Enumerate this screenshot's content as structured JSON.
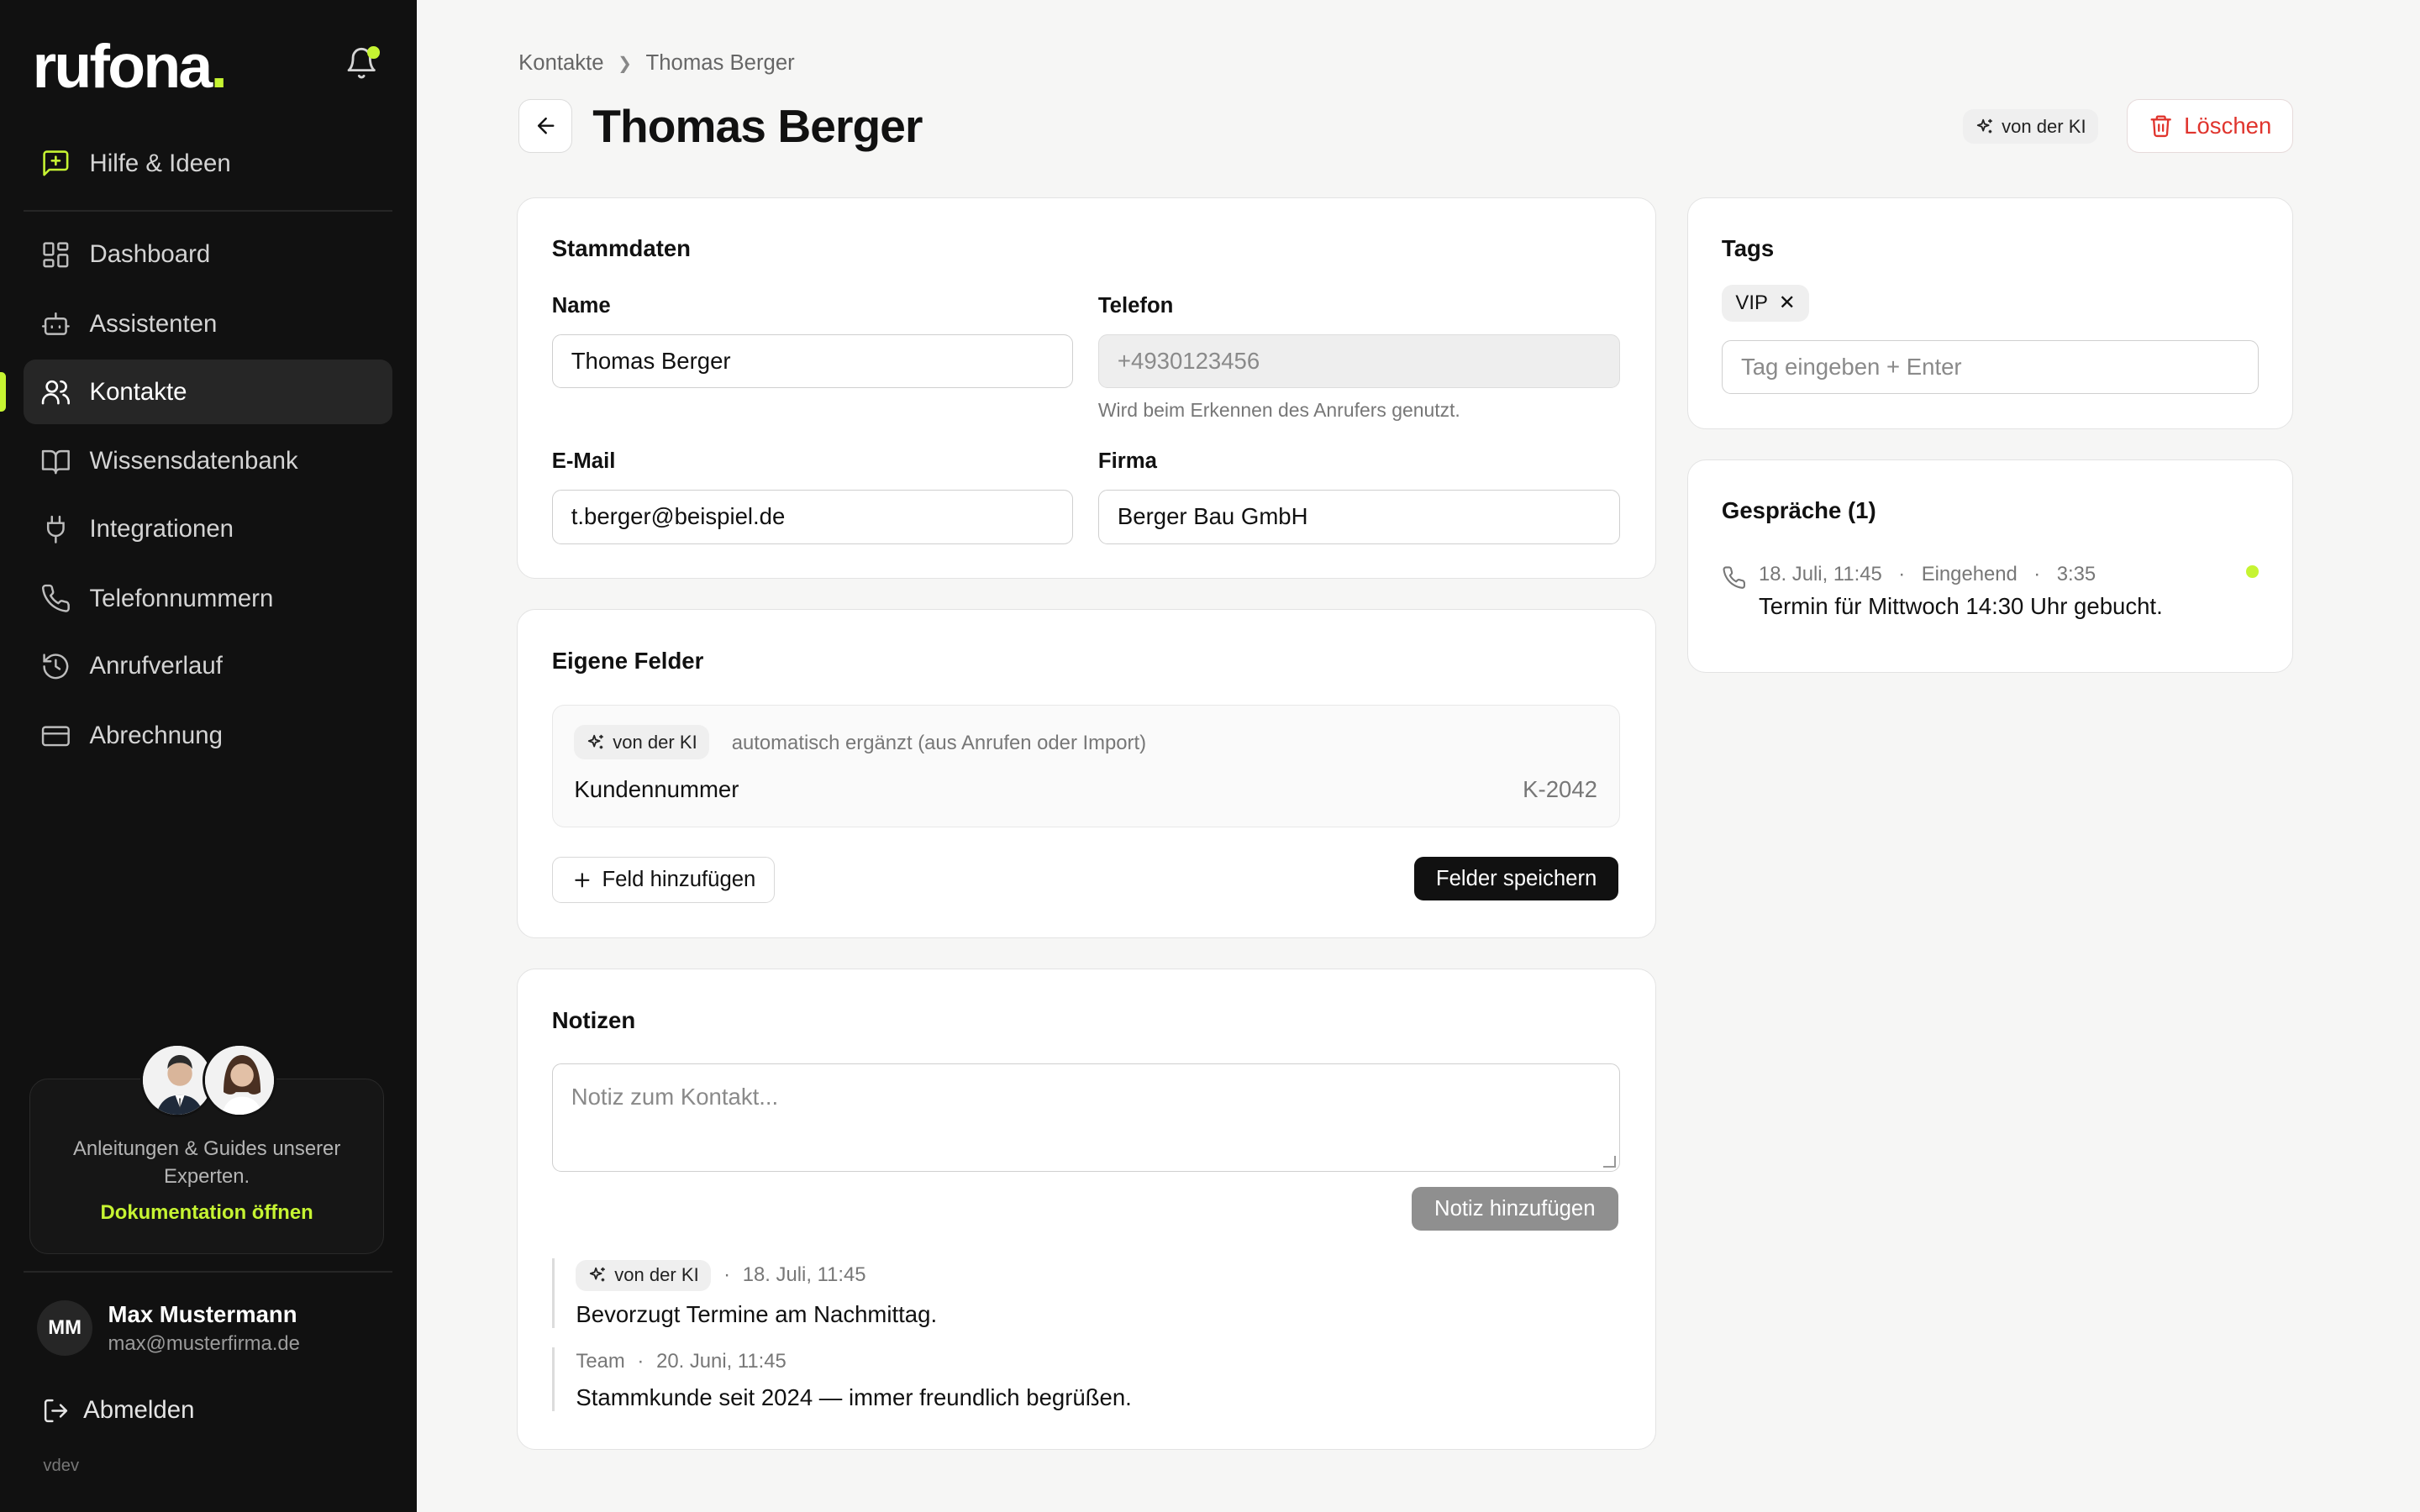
{
  "brand": {
    "name": "rufona",
    "dot": ".",
    "accent": "#c6f432"
  },
  "sidebar": {
    "help": "Hilfe & Ideen",
    "items": [
      {
        "label": "Dashboard",
        "icon": "grid-icon"
      },
      {
        "label": "Assistenten",
        "icon": "robot-icon"
      },
      {
        "label": "Kontakte",
        "icon": "users-icon",
        "active": true
      },
      {
        "label": "Wissensdatenbank",
        "icon": "book-icon"
      },
      {
        "label": "Integrationen",
        "icon": "plug-icon"
      },
      {
        "label": "Telefonnummern",
        "icon": "phone-icon"
      },
      {
        "label": "Anrufverlauf",
        "icon": "history-icon"
      },
      {
        "label": "Abrechnung",
        "icon": "credit-card-icon"
      }
    ],
    "guide": {
      "text": "Anleitungen & Guides unserer Experten.",
      "link": "Dokumentation öffnen"
    },
    "user": {
      "initials": "MM",
      "name": "Max Mustermann",
      "email": "max@musterfirma.de"
    },
    "logout": "Abmelden",
    "version": "vdev"
  },
  "header": {
    "breadcrumb": [
      "Kontakte",
      "Thomas Berger"
    ],
    "title": "Thomas Berger",
    "ai_badge": "von der KI",
    "delete": "Löschen"
  },
  "stammdaten": {
    "title": "Stammdaten",
    "name_label": "Name",
    "name_value": "Thomas Berger",
    "phone_label": "Telefon",
    "phone_value": "+4930123456",
    "phone_hint": "Wird beim Erkennen des Anrufers genutzt.",
    "email_label": "E-Mail",
    "email_value": "t.berger@beispiel.de",
    "company_label": "Firma",
    "company_value": "Berger Bau GmbH"
  },
  "custom_fields": {
    "title": "Eigene Felder",
    "ai_badge": "von der KI",
    "ai_note": "automatisch ergänzt (aus Anrufen oder Import)",
    "key": "Kundennummer",
    "value": "K-2042",
    "add": "Feld hinzufügen",
    "save": "Felder speichern"
  },
  "notes": {
    "title": "Notizen",
    "placeholder": "Notiz zum Kontakt...",
    "add": "Notiz hinzufügen",
    "items": [
      {
        "author": "von der KI",
        "time": "18. Juli, 11:45",
        "text": "Bevorzugt Termine am Nachmittag."
      },
      {
        "author": "Team",
        "time": "20. Juni, 11:45",
        "text": "Stammkunde seit 2024 — immer freundlich begrüßen."
      }
    ]
  },
  "tags": {
    "title": "Tags",
    "items": [
      "VIP"
    ],
    "placeholder": "Tag eingeben + Enter"
  },
  "calls": {
    "title": "Gespräche (1)",
    "items": [
      {
        "date": "18. Juli, 11:45",
        "direction": "Eingehend",
        "duration": "3:35",
        "summary": "Termin für Mittwoch 14:30 Uhr gebucht."
      }
    ]
  }
}
